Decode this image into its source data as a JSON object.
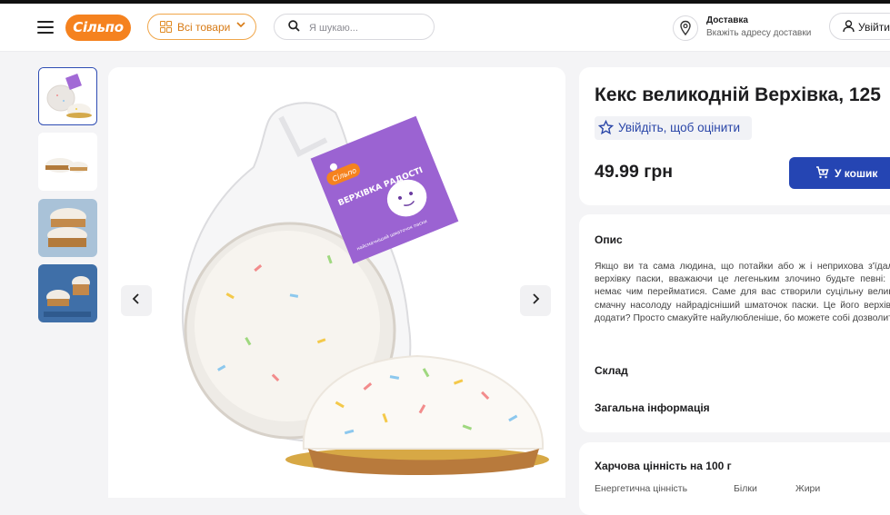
{
  "header": {
    "logo_text": "Сільпо",
    "catalog_label": "Всі товари",
    "search_placeholder": "Я шукаю...",
    "delivery_title": "Доставка",
    "delivery_subtitle": "Вкажіть адресу доставки",
    "login_label": "Увійти"
  },
  "product": {
    "title": "Кекс великодній Верхівка, 125",
    "rate_label": "Увійдіть, щоб оцінити",
    "price": "49.99 грн",
    "cart_label": "У кошик"
  },
  "gallery": {
    "package_tag": "ВЕРХІВКА РАДОСТІ",
    "package_tag_sub": "найсмачніший шматочок паски"
  },
  "sections": {
    "description_title": "Опис",
    "description_text": "Якщо ви та сама людина, що потайки або ж і неприхова з'їдала лиш верхівку паски, вважаючи це легеньким злочино будьте певні: більше немає чим перейматися. Саме для вас створили суцільну великодньо-смачну насолоду найрадісніший шматочок паски. Це його верхівка. Що додати? Просто смакуйте найулюбленіше, бо можете собі дозволити.",
    "composition_title": "Склад",
    "general_info_title": "Загальна інформація",
    "nutrition_title": "Харчова цінність на 100 г",
    "nutrition_cols": [
      "Енергетична цінність",
      "Білки",
      "Жири"
    ]
  },
  "colors": {
    "accent": "#2545b3",
    "brand": "#f5821f"
  }
}
